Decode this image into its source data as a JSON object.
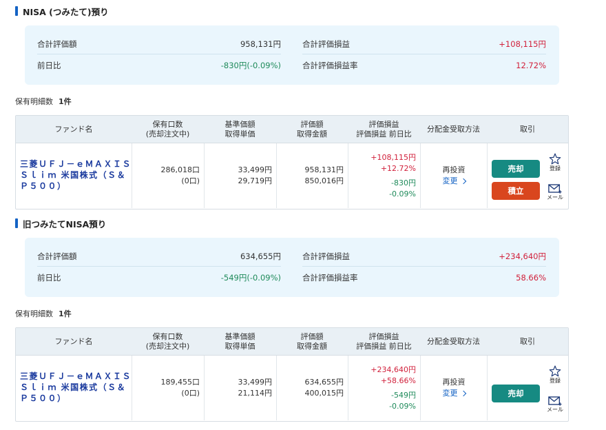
{
  "sections": [
    {
      "title": "NISA (つみたて)預り",
      "summary": {
        "total_value_label": "合計評価額",
        "total_value": "958,131円",
        "daily_change_label": "前日比",
        "daily_change": "-830円(-0.09%)",
        "total_gain_label": "合計評価損益",
        "total_gain": "+108,115円",
        "total_gain_rate_label": "合計評価損益率",
        "total_gain_rate": "12.72%"
      },
      "holdings_label": "保有明細数",
      "holdings_count": "1件",
      "table": {
        "headers": {
          "fund": "ファンド名",
          "units_1": "保有口数",
          "units_2": "(売却注文中)",
          "price_1": "基準価額",
          "price_2": "取得単価",
          "value_1": "評価額",
          "value_2": "取得金額",
          "gain_1": "評価損益",
          "gain_2": "評価損益 前日比",
          "dist": "分配金受取方法",
          "trade": "取引"
        },
        "row": {
          "fund_name": "三菱ＵＦＪ－ｅＭＡＸＩＳ Ｓｌｉｍ 米国株式（Ｓ＆Ｐ５００）",
          "units": "286,018口",
          "units_pending": "(0口)",
          "nav": "33,499円",
          "cost_unit": "29,719円",
          "value": "958,131円",
          "cost_total": "850,016円",
          "gain": "+108,115円",
          "gain_rate": "+12.72%",
          "day_change": "-830円",
          "day_change_rate": "-0.09%",
          "dist_method": "再投資",
          "change_label": "変更",
          "sell_label": "売却",
          "accumulate_label": "積立",
          "register_label": "登録",
          "mail_label": "メール"
        }
      }
    },
    {
      "title": "旧つみたてNISA預り",
      "summary": {
        "total_value_label": "合計評価額",
        "total_value": "634,655円",
        "daily_change_label": "前日比",
        "daily_change": "-549円(-0.09%)",
        "total_gain_label": "合計評価損益",
        "total_gain": "+234,640円",
        "total_gain_rate_label": "合計評価損益率",
        "total_gain_rate": "58.66%"
      },
      "holdings_label": "保有明細数",
      "holdings_count": "1件",
      "table": {
        "headers": {
          "fund": "ファンド名",
          "units_1": "保有口数",
          "units_2": "(売却注文中)",
          "price_1": "基準価額",
          "price_2": "取得単価",
          "value_1": "評価額",
          "value_2": "取得金額",
          "gain_1": "評価損益",
          "gain_2": "評価損益 前日比",
          "dist": "分配金受取方法",
          "trade": "取引"
        },
        "row": {
          "fund_name": "三菱ＵＦＪ－ｅＭＡＸＩＳ Ｓｌｉｍ 米国株式（Ｓ＆Ｐ５００）",
          "units": "189,455口",
          "units_pending": "(0口)",
          "nav": "33,499円",
          "cost_unit": "21,114円",
          "value": "634,655円",
          "cost_total": "400,015円",
          "gain": "+234,640円",
          "gain_rate": "+58.66%",
          "day_change": "-549円",
          "day_change_rate": "-0.09%",
          "dist_method": "再投資",
          "change_label": "変更",
          "sell_label": "売却",
          "register_label": "登録",
          "mail_label": "メール"
        }
      }
    }
  ],
  "colors": {
    "positive": "#d1203b",
    "negative": "#1e8a5a",
    "link": "#1463c4",
    "sell_button": "#168a82",
    "accumulate_button": "#d9461e",
    "summary_bg": "#eaf6fd"
  },
  "icons": [
    "star-icon",
    "mail-icon",
    "chevron-right-icon"
  ]
}
